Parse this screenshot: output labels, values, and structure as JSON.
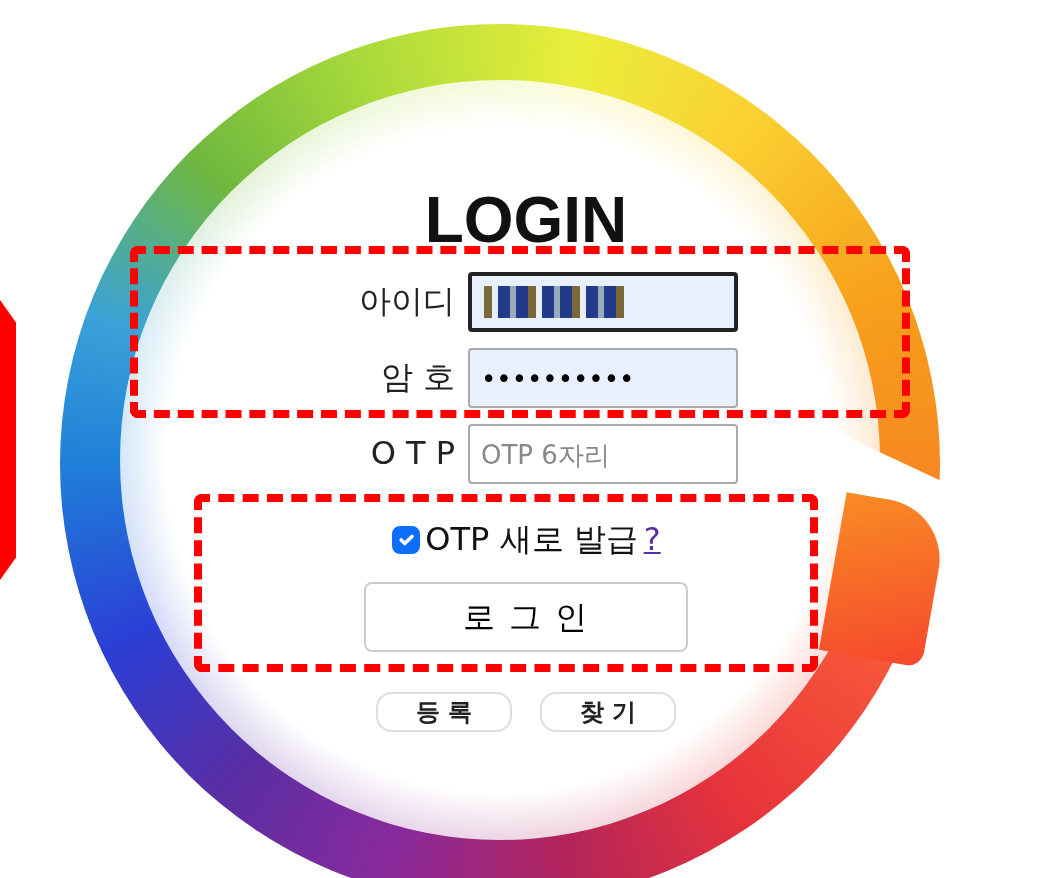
{
  "title": "LOGIN",
  "fields": [
    {
      "label": "아이디",
      "kind": "masked",
      "focused": true
    },
    {
      "label": "암 호",
      "kind": "password",
      "value": "••••••••••",
      "focused": false
    },
    {
      "label": "O T P",
      "kind": "text",
      "placeholder": "OTP 6자리",
      "focused": false
    }
  ],
  "otp_renew": {
    "label": "OTP 새로 발급",
    "checked": true,
    "help_link": "?"
  },
  "login_button": "로 그 인",
  "buttons": [
    "등 록",
    "찾 기"
  ]
}
